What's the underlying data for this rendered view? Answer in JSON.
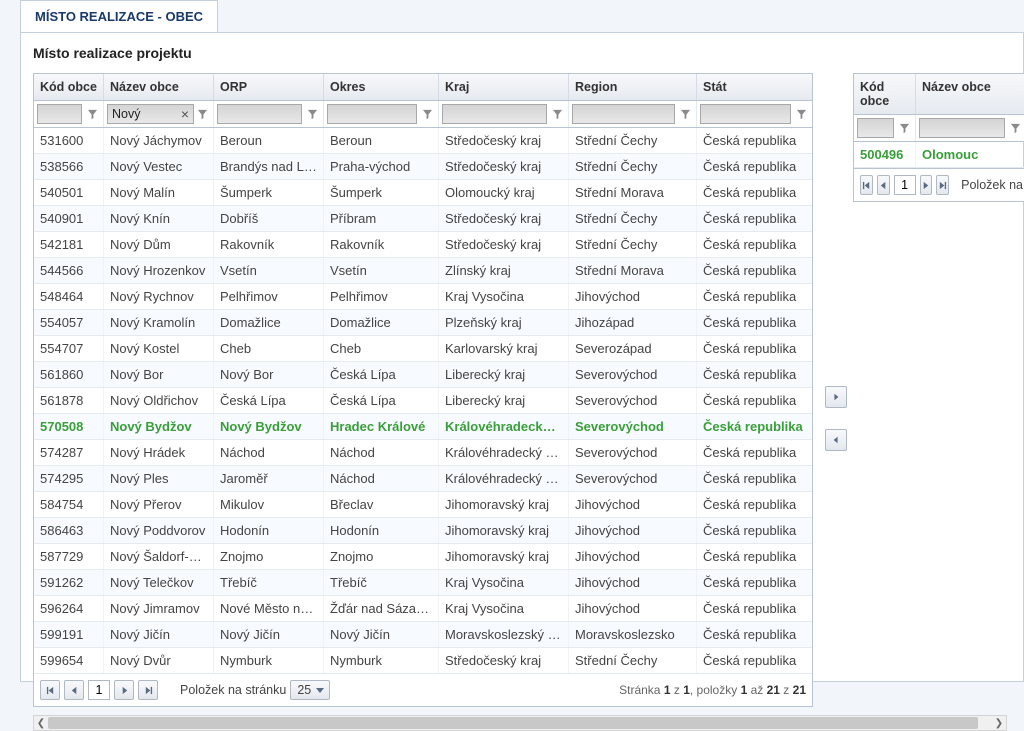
{
  "tab_title": "MÍSTO REALIZACE - OBEC",
  "subtitle": "Místo realizace projektu",
  "left_grid": {
    "headers": [
      "Kód obce",
      "Název obce",
      "ORP",
      "Okres",
      "Kraj",
      "Region",
      "Stát"
    ],
    "filter_value_col2": "Nový",
    "rows": [
      {
        "sel": false,
        "c": [
          "531600",
          "Nový Jáchymov",
          "Beroun",
          "Beroun",
          "Středočeský kraj",
          "Střední Čechy",
          "Česká republika"
        ]
      },
      {
        "sel": false,
        "c": [
          "538566",
          "Nový Vestec",
          "Brandýs nad Lab...",
          "Praha-východ",
          "Středočeský kraj",
          "Střední Čechy",
          "Česká republika"
        ]
      },
      {
        "sel": false,
        "c": [
          "540501",
          "Nový Malín",
          "Šumperk",
          "Šumperk",
          "Olomoucký kraj",
          "Střední Morava",
          "Česká republika"
        ]
      },
      {
        "sel": false,
        "c": [
          "540901",
          "Nový Knín",
          "Dobříš",
          "Příbram",
          "Středočeský kraj",
          "Střední Čechy",
          "Česká republika"
        ]
      },
      {
        "sel": false,
        "c": [
          "542181",
          "Nový Dům",
          "Rakovník",
          "Rakovník",
          "Středočeský kraj",
          "Střední Čechy",
          "Česká republika"
        ]
      },
      {
        "sel": false,
        "c": [
          "544566",
          "Nový Hrozenkov",
          "Vsetín",
          "Vsetín",
          "Zlínský kraj",
          "Střední Morava",
          "Česká republika"
        ]
      },
      {
        "sel": false,
        "c": [
          "548464",
          "Nový Rychnov",
          "Pelhřimov",
          "Pelhřimov",
          "Kraj Vysočina",
          "Jihovýchod",
          "Česká republika"
        ]
      },
      {
        "sel": false,
        "c": [
          "554057",
          "Nový Kramolín",
          "Domažlice",
          "Domažlice",
          "Plzeňský kraj",
          "Jihozápad",
          "Česká republika"
        ]
      },
      {
        "sel": false,
        "c": [
          "554707",
          "Nový Kostel",
          "Cheb",
          "Cheb",
          "Karlovarský kraj",
          "Severozápad",
          "Česká republika"
        ]
      },
      {
        "sel": false,
        "c": [
          "561860",
          "Nový Bor",
          "Nový Bor",
          "Česká Lípa",
          "Liberecký kraj",
          "Severovýchod",
          "Česká republika"
        ]
      },
      {
        "sel": false,
        "c": [
          "561878",
          "Nový Oldřichov",
          "Česká Lípa",
          "Česká Lípa",
          "Liberecký kraj",
          "Severovýchod",
          "Česká republika"
        ]
      },
      {
        "sel": true,
        "c": [
          "570508",
          "Nový Bydžov",
          "Nový Bydžov",
          "Hradec Králové",
          "Královéhradecký kraj",
          "Severovýchod",
          "Česká republika"
        ]
      },
      {
        "sel": false,
        "c": [
          "574287",
          "Nový Hrádek",
          "Náchod",
          "Náchod",
          "Královéhradecký kraj",
          "Severovýchod",
          "Česká republika"
        ]
      },
      {
        "sel": false,
        "c": [
          "574295",
          "Nový Ples",
          "Jaroměř",
          "Náchod",
          "Královéhradecký kraj",
          "Severovýchod",
          "Česká republika"
        ]
      },
      {
        "sel": false,
        "c": [
          "584754",
          "Nový Přerov",
          "Mikulov",
          "Břeclav",
          "Jihomoravský kraj",
          "Jihovýchod",
          "Česká republika"
        ]
      },
      {
        "sel": false,
        "c": [
          "586463",
          "Nový Poddvorov",
          "Hodonín",
          "Hodonín",
          "Jihomoravský kraj",
          "Jihovýchod",
          "Česká republika"
        ]
      },
      {
        "sel": false,
        "c": [
          "587729",
          "Nový Šaldorf-Sed...",
          "Znojmo",
          "Znojmo",
          "Jihomoravský kraj",
          "Jihovýchod",
          "Česká republika"
        ]
      },
      {
        "sel": false,
        "c": [
          "591262",
          "Nový Telečkov",
          "Třebíč",
          "Třebíč",
          "Kraj Vysočina",
          "Jihovýchod",
          "Česká republika"
        ]
      },
      {
        "sel": false,
        "c": [
          "596264",
          "Nový Jimramov",
          "Nové Město na M...",
          "Žďár nad Sázavou",
          "Kraj Vysočina",
          "Jihovýchod",
          "Česká republika"
        ]
      },
      {
        "sel": false,
        "c": [
          "599191",
          "Nový Jičín",
          "Nový Jičín",
          "Nový Jičín",
          "Moravskoslezský kraj",
          "Moravskoslezsko",
          "Česká republika"
        ]
      },
      {
        "sel": false,
        "c": [
          "599654",
          "Nový Dvůr",
          "Nymburk",
          "Nymburk",
          "Středočeský kraj",
          "Střední Čechy",
          "Česká republika"
        ]
      }
    ],
    "pager": {
      "page": "1",
      "per_page_label": "Položek na stránku",
      "per_page_value": "25",
      "info_prefix": "Stránka ",
      "info_page": "1",
      "info_mid1": " z ",
      "info_total_pages": "1",
      "info_mid2": ", položky ",
      "info_from": "1",
      "info_mid3": " až ",
      "info_to": "21",
      "info_mid4": " z ",
      "info_total": "21"
    }
  },
  "right_grid": {
    "headers": [
      "Kód obce",
      "Název obce"
    ],
    "rows": [
      {
        "c": [
          "500496",
          "Olomouc"
        ]
      }
    ],
    "pager": {
      "page": "1",
      "trailing_label": "Položek na"
    }
  }
}
